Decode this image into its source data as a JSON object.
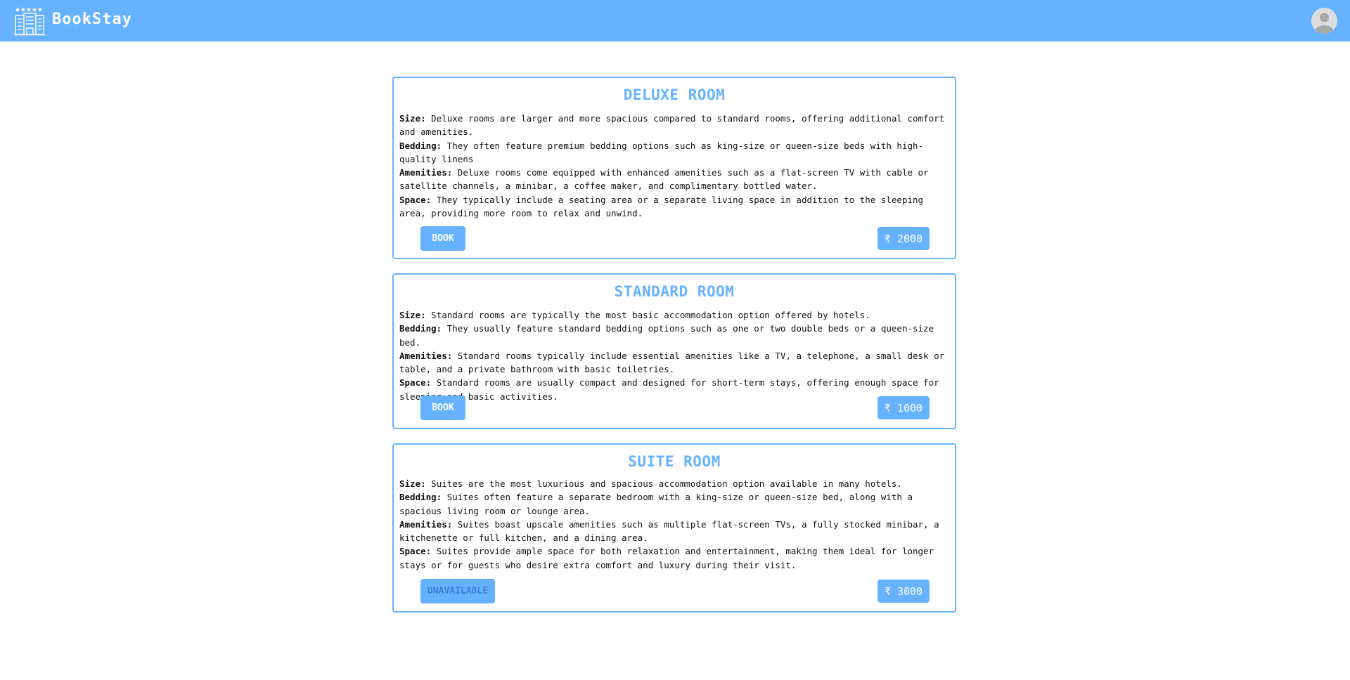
{
  "app": {
    "brand": "BookStay",
    "colors": {
      "accent": "#66b2ff",
      "unavailable_text": "#3d7fd1"
    },
    "icons": {
      "logo": "hotel-building-icon",
      "profile": "user-avatar-icon"
    }
  },
  "labels": {
    "size": "Size:",
    "bedding": "Bedding:",
    "amenities": "Amenities:",
    "space": "Space:"
  },
  "rooms": [
    {
      "title": "DELUXE ROOM",
      "size": "Deluxe rooms are larger and more spacious compared to standard rooms, offering additional comfort and amenities.",
      "bedding": "They often feature premium bedding options such as king-size or queen-size beds with high-quality linens",
      "amenities": "Deluxe rooms come equipped with enhanced amenities such as a flat-screen TV with cable or satellite channels, a minibar, a coffee maker, and complimentary bottled water.",
      "space": "They typically include a seating area or a separate living space in addition to the sleeping area, providing more room to relax and unwind.",
      "action": "BOOK",
      "available": true,
      "price": "₹ 2000"
    },
    {
      "title": "STANDARD ROOM",
      "size": "Standard rooms are typically the most basic accommodation option offered by hotels.",
      "bedding": "They usually feature standard bedding options such as one or two double beds or a queen-size bed.",
      "amenities": "Standard rooms typically include essential amenities like a TV, a telephone, a small desk or table, and a private bathroom with basic toiletries.",
      "space": "Standard rooms are usually compact and designed for short-term stays, offering enough space for sleeping and basic activities.",
      "action": "BOOK",
      "available": true,
      "price": "₹ 1000"
    },
    {
      "title": "SUITE ROOM",
      "size": "Suites are the most luxurious and spacious accommodation option available in many hotels.",
      "bedding": "Suites often feature a separate bedroom with a king-size or queen-size bed, along with a spacious living room or lounge area.",
      "amenities": "Suites boast upscale amenities such as multiple flat-screen TVs, a fully stocked minibar, a kitchenette or full kitchen, and a dining area.",
      "space": "Suites provide ample space for both relaxation and entertainment, making them ideal for longer stays or for guests who desire extra comfort and luxury during their visit.",
      "action": "UNAVAILABLE",
      "available": false,
      "price": "₹ 3000"
    }
  ]
}
